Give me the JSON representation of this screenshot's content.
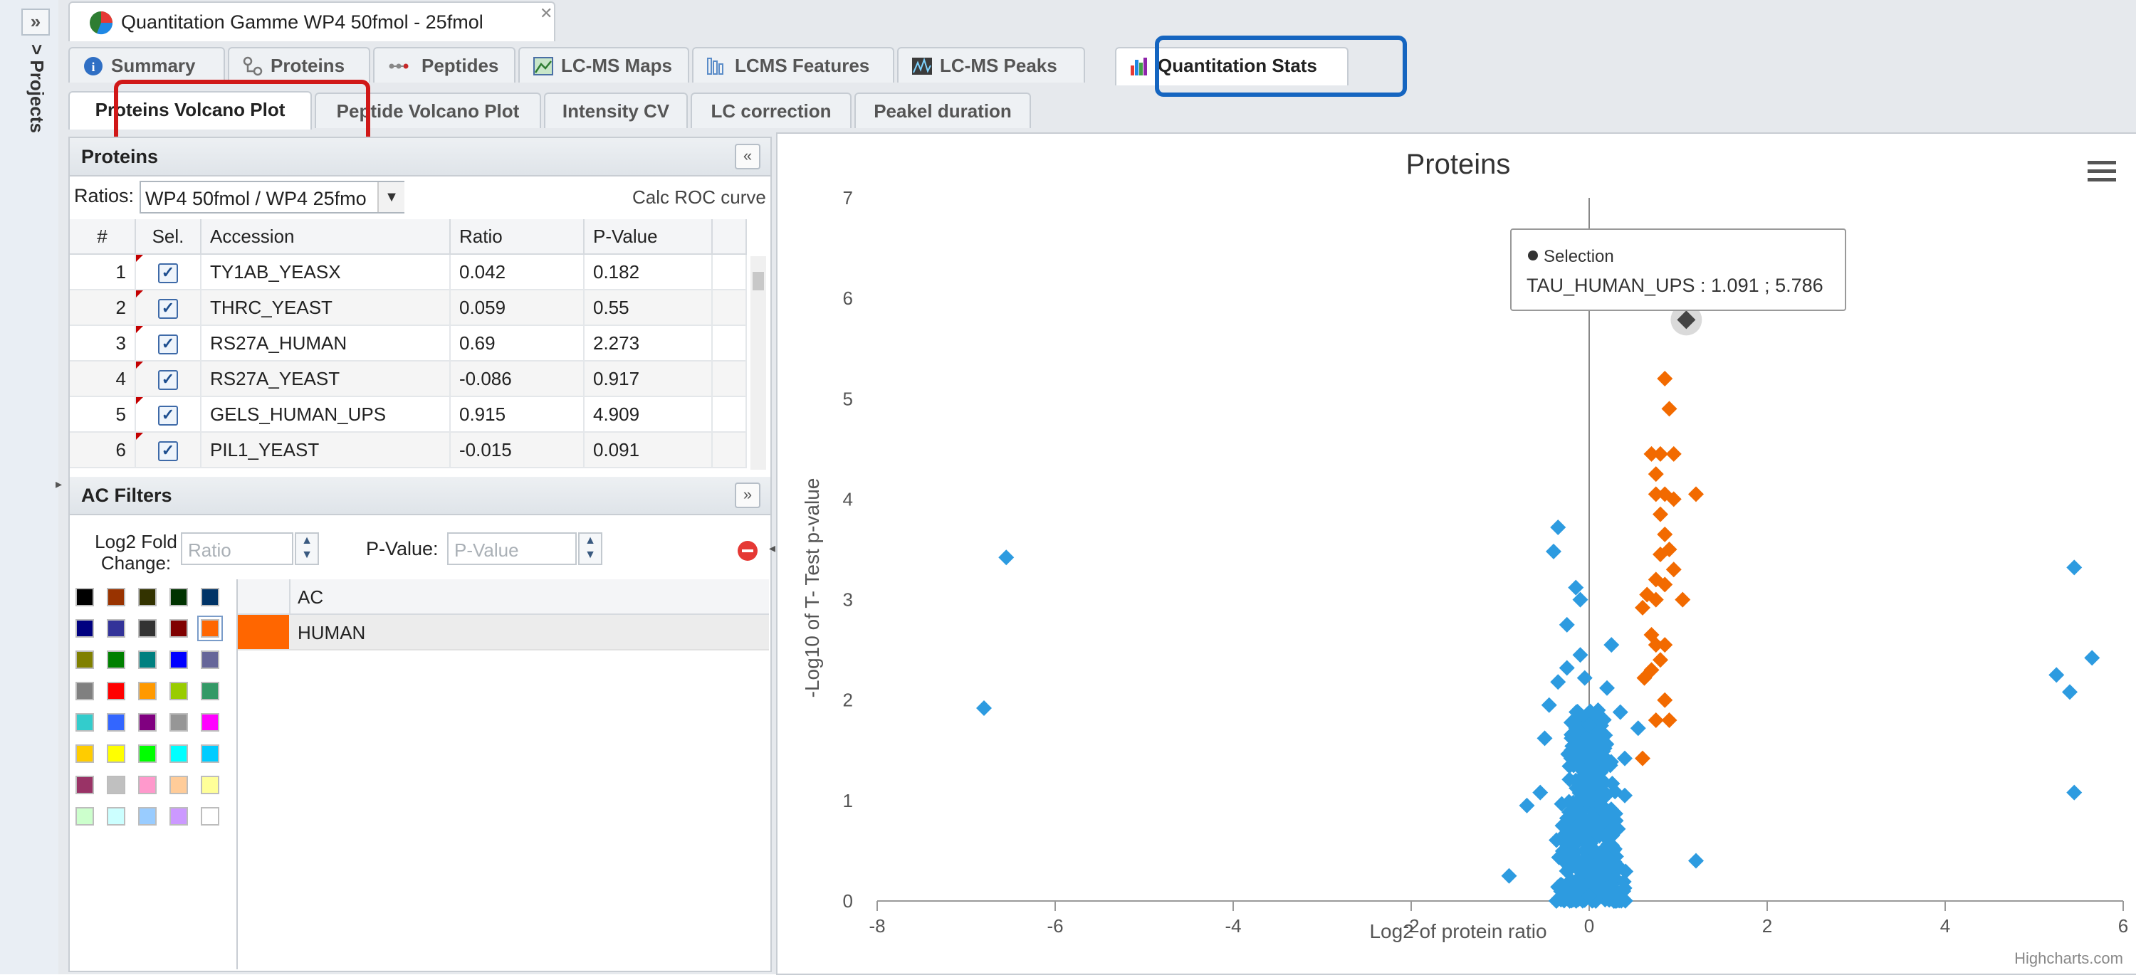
{
  "sidebar": {
    "expand_icon": "double-chevron-right-icon",
    "label": "> Projects"
  },
  "document_tab": {
    "title": "Quantitation Gamme WP4 50fmol - 25fmol",
    "icon": "pie-chart-icon"
  },
  "main_tabs": [
    {
      "label": "Summary",
      "icon": "info-icon"
    },
    {
      "label": "Proteins",
      "icon": "tree-icon"
    },
    {
      "label": "Peptides",
      "icon": "peptide-icon"
    },
    {
      "label": "LC-MS Maps",
      "icon": "map-icon"
    },
    {
      "label": "LCMS Features",
      "icon": "features-icon"
    },
    {
      "label": "LC-MS Peaks",
      "icon": "peaks-icon"
    },
    {
      "label": "Quantitation Stats",
      "icon": "bar-chart-icon",
      "active": true
    }
  ],
  "sub_tabs": [
    {
      "label": "Proteins Volcano Plot",
      "active": true
    },
    {
      "label": "Peptide Volcano Plot"
    },
    {
      "label": "Intensity CV"
    },
    {
      "label": "LC correction"
    },
    {
      "label": "Peakel duration"
    }
  ],
  "proteins_panel": {
    "title": "Proteins",
    "ratios_label": "Ratios:",
    "ratios_value": "WP4 50fmol / WP4 25fmo",
    "roc_link": "Calc ROC curve",
    "columns": [
      "#",
      "Sel.",
      "Accession",
      "Ratio",
      "P-Value"
    ],
    "rows": [
      {
        "num": "1",
        "accession": "TY1AB_YEASX",
        "ratio": "0.042",
        "pvalue": "0.182"
      },
      {
        "num": "2",
        "accession": "THRC_YEAST",
        "ratio": "0.059",
        "pvalue": "0.55"
      },
      {
        "num": "3",
        "accession": "RS27A_HUMAN",
        "ratio": "0.69",
        "pvalue": "2.273"
      },
      {
        "num": "4",
        "accession": "RS27A_YEAST",
        "ratio": "-0.086",
        "pvalue": "0.917"
      },
      {
        "num": "5",
        "accession": "GELS_HUMAN_UPS",
        "ratio": "0.915",
        "pvalue": "4.909"
      },
      {
        "num": "6",
        "accession": "PIL1_YEAST",
        "ratio": "-0.015",
        "pvalue": "0.091"
      }
    ]
  },
  "filters_panel": {
    "title": "AC Filters",
    "fold_label": "Log2 Fold\nChange:",
    "fold_placeholder": "Ratio",
    "pvalue_label": "P-Value:",
    "pvalue_placeholder": "P-Value",
    "ac_header": "AC",
    "ac_rows": [
      {
        "label": "HUMAN",
        "color": "#ff6600"
      }
    ],
    "palette": [
      [
        "#000000",
        "#993300",
        "#333300",
        "#003300",
        "#003366"
      ],
      [
        "#000080",
        "#333399",
        "#333333",
        "#800000",
        "#ff6600"
      ],
      [
        "#808000",
        "#008000",
        "#008080",
        "#0000ff",
        "#666699"
      ],
      [
        "#808080",
        "#ff0000",
        "#ff9900",
        "#99cc00",
        "#339966"
      ],
      [
        "#33cccc",
        "#3366ff",
        "#800080",
        "#969696",
        "#ff00ff"
      ],
      [
        "#ffcc00",
        "#ffff00",
        "#00ff00",
        "#00ffff",
        "#00ccff"
      ],
      [
        "#993366",
        "#c0c0c0",
        "#ff99cc",
        "#ffcc99",
        "#ffff99"
      ],
      [
        "#ccffcc",
        "#ccffff",
        "#99ccff",
        "#cc99ff",
        "#ffffff"
      ]
    ]
  },
  "chart_data": {
    "type": "scatter",
    "title": "Proteins",
    "xlabel": "Log2 of protein ratio",
    "ylabel": "-Log10 of T- Test p-value",
    "xlim": [
      -8,
      6
    ],
    "ylim": [
      0,
      7
    ],
    "xticks": [
      "-8",
      "-6",
      "-4",
      "-2",
      "0",
      "2",
      "4",
      "6"
    ],
    "yticks": [
      "0",
      "1",
      "2",
      "3",
      "4",
      "5",
      "6",
      "7"
    ],
    "credits": "Highcharts.com",
    "menu_icon": "hamburger-menu-icon",
    "colors": {
      "blue": "#2d9be0",
      "orange": "#f26a00",
      "selected": "#444444"
    },
    "tooltip": {
      "series": "Selection",
      "text": "TAU_HUMAN_UPS : 1.091 ; 5.786"
    },
    "selected_point": {
      "x": 1.091,
      "y": 5.786
    },
    "series": [
      {
        "color": "blue",
        "points": [
          [
            -6.55,
            3.42
          ],
          [
            -6.8,
            1.92
          ],
          [
            5.45,
            3.32
          ],
          [
            5.65,
            2.42
          ],
          [
            5.25,
            2.25
          ],
          [
            5.4,
            2.08
          ],
          [
            5.45,
            1.08
          ],
          [
            1.2,
            0.4
          ],
          [
            -0.9,
            0.25
          ],
          [
            -0.35,
            3.72
          ],
          [
            -0.4,
            3.48
          ],
          [
            -0.15,
            3.12
          ],
          [
            -0.1,
            3.0
          ],
          [
            -0.25,
            2.75
          ],
          [
            -0.25,
            2.32
          ],
          [
            -0.1,
            2.45
          ],
          [
            0.25,
            2.55
          ],
          [
            -0.35,
            2.18
          ],
          [
            0.55,
            1.72
          ],
          [
            0.35,
            1.88
          ],
          [
            -0.5,
            1.62
          ],
          [
            0.4,
            1.42
          ],
          [
            -0.55,
            1.08
          ],
          [
            -0.7,
            0.95
          ],
          [
            0.4,
            1.05
          ],
          [
            -0.45,
            1.95
          ],
          [
            0.2,
            2.12
          ],
          [
            -0.05,
            2.22
          ],
          [
            0.3,
            0.8
          ],
          [
            -0.3,
            0.75
          ],
          [
            0.0,
            0.05
          ],
          [
            -0.05,
            0.3
          ],
          [
            0.05,
            0.5
          ],
          [
            0.15,
            0.9
          ],
          [
            -0.15,
            1.2
          ],
          [
            0.1,
            1.6
          ],
          [
            -0.2,
            1.5
          ],
          [
            0.2,
            1.35
          ],
          [
            -0.1,
            0.65
          ],
          [
            0.25,
            0.35
          ],
          [
            -0.25,
            0.45
          ],
          [
            0.0,
            1.75
          ],
          [
            0.1,
            1.9
          ],
          [
            -0.05,
            1.45
          ]
        ]
      },
      {
        "color": "orange",
        "points": [
          [
            0.85,
            5.2
          ],
          [
            0.9,
            4.9
          ],
          [
            0.7,
            4.45
          ],
          [
            0.8,
            4.45
          ],
          [
            0.95,
            4.45
          ],
          [
            0.75,
            4.25
          ],
          [
            0.85,
            4.05
          ],
          [
            0.75,
            4.05
          ],
          [
            0.95,
            4.0
          ],
          [
            1.2,
            4.05
          ],
          [
            0.8,
            3.85
          ],
          [
            0.85,
            3.65
          ],
          [
            0.9,
            3.5
          ],
          [
            0.8,
            3.45
          ],
          [
            0.75,
            3.2
          ],
          [
            0.85,
            3.15
          ],
          [
            0.95,
            3.3
          ],
          [
            0.65,
            3.05
          ],
          [
            0.6,
            2.92
          ],
          [
            0.75,
            3.0
          ],
          [
            1.05,
            3.0
          ],
          [
            0.7,
            2.65
          ],
          [
            0.75,
            2.55
          ],
          [
            0.85,
            2.55
          ],
          [
            0.8,
            2.4
          ],
          [
            0.7,
            2.3
          ],
          [
            0.62,
            2.22
          ],
          [
            0.85,
            2.0
          ],
          [
            0.75,
            1.8
          ],
          [
            0.9,
            1.8
          ],
          [
            0.6,
            1.42
          ]
        ]
      }
    ]
  }
}
